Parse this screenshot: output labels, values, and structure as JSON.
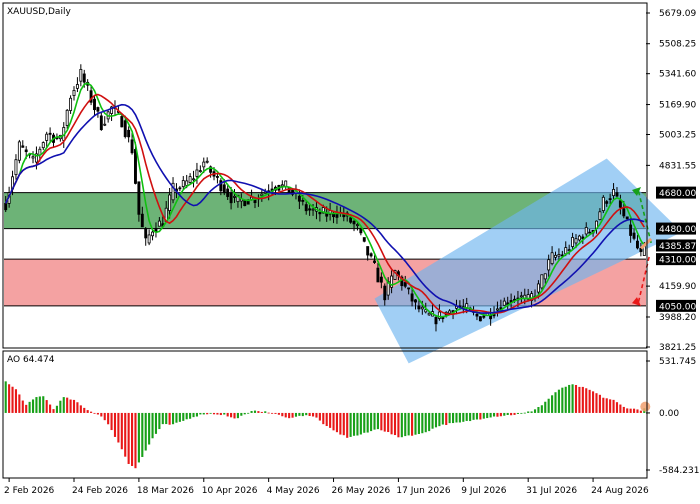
{
  "window": {
    "title": "XAUUSD,Daily",
    "indicator_label": "AO 64.474"
  },
  "colors": {
    "bull_candle": "#ffffff",
    "candle_outline": "#000000",
    "ma_fast": "#10c010",
    "ma_mid": "#d01010",
    "ma_slow": "#1010b0",
    "green_zone": "#3c9a4a",
    "red_zone": "#f07a7a",
    "channel": "#6eb6f0",
    "ao_up": "#18a018",
    "ao_down": "#e81818",
    "forecast_up": "#18a018",
    "forecast_down": "#e81818",
    "forecast_mid": "#f0a070"
  },
  "chart_data": [
    {
      "type": "candlestick",
      "title": "XAUUSD,Daily",
      "ylim": [
        3821.25,
        5700.0
      ],
      "y_ticks": [
        "5679.09",
        "5508.25",
        "5341.60",
        "5169.90",
        "5003.25",
        "4831.55",
        "4159.90",
        "3988.20",
        "3821.25"
      ],
      "y_tick_values": [
        5679.09,
        5508.25,
        5341.6,
        5169.9,
        5003.25,
        4831.55,
        4159.9,
        3988.2,
        3821.25
      ],
      "x_ticks": [
        "2 Feb 2026",
        "24 Feb 2026",
        "18 Mar 2026",
        "10 Apr 2026",
        "4 May 2026",
        "26 May 2026",
        "17 Jun 2026",
        "9 Jul 2026",
        "31 Jul 2026",
        "24 Aug 2026"
      ],
      "x_tick_bars": [
        1,
        20,
        39,
        58,
        77,
        96,
        115,
        134,
        153,
        172
      ],
      "total_bars": 188,
      "levels": [
        {
          "label": "4680.00",
          "value": 4680.0
        },
        {
          "label": "4480.00",
          "value": 4480.0
        },
        {
          "label": "4385.87",
          "value": 4385.87
        },
        {
          "label": "4310.00",
          "value": 4310.0
        },
        {
          "label": "4050.00",
          "value": 4050.0
        }
      ],
      "zones": [
        {
          "from": 4480.0,
          "to": 4680.0,
          "kind": "green"
        },
        {
          "from": 4050.0,
          "to": 4310.0,
          "kind": "red"
        }
      ],
      "channel": {
        "lower": [
          [
            108,
            4020
          ],
          [
            188,
            4520
          ]
        ],
        "upper": [
          [
            188,
            4840
          ]
        ],
        "corners": [
          [
            108,
            4090
          ],
          [
            176,
            4870
          ],
          [
            198,
            4460
          ],
          [
            118,
            3730
          ]
        ]
      },
      "forecast": {
        "start": [
          189,
          4400
        ],
        "up_end": [
          200,
          4700
        ],
        "down_end": [
          200,
          4060
        ],
        "mid_end": [
          196,
          4370
        ]
      },
      "series_keypoints": [
        [
          0,
          4620
        ],
        [
          4,
          4940
        ],
        [
          8,
          4850
        ],
        [
          12,
          5010
        ],
        [
          16,
          4970
        ],
        [
          19,
          5220
        ],
        [
          22,
          5340
        ],
        [
          25,
          5200
        ],
        [
          28,
          5060
        ],
        [
          31,
          5150
        ],
        [
          34,
          5080
        ],
        [
          37,
          4920
        ],
        [
          39,
          4560
        ],
        [
          41,
          4400
        ],
        [
          43,
          4480
        ],
        [
          46,
          4520
        ],
        [
          49,
          4700
        ],
        [
          52,
          4720
        ],
        [
          55,
          4770
        ],
        [
          58,
          4850
        ],
        [
          61,
          4770
        ],
        [
          64,
          4700
        ],
        [
          67,
          4630
        ],
        [
          70,
          4640
        ],
        [
          73,
          4650
        ],
        [
          76,
          4690
        ],
        [
          79,
          4720
        ],
        [
          82,
          4710
        ],
        [
          85,
          4660
        ],
        [
          88,
          4590
        ],
        [
          91,
          4570
        ],
        [
          94,
          4560
        ],
        [
          97,
          4570
        ],
        [
          100,
          4540
        ],
        [
          103,
          4480
        ],
        [
          105,
          4380
        ],
        [
          108,
          4260
        ],
        [
          111,
          4110
        ],
        [
          114,
          4240
        ],
        [
          117,
          4150
        ],
        [
          120,
          4050
        ],
        [
          123,
          4000
        ],
        [
          126,
          3980
        ],
        [
          129,
          4010
        ],
        [
          132,
          4050
        ],
        [
          135,
          4030
        ],
        [
          138,
          3990
        ],
        [
          141,
          4000
        ],
        [
          144,
          4040
        ],
        [
          147,
          4080
        ],
        [
          150,
          4100
        ],
        [
          153,
          4080
        ],
        [
          156,
          4150
        ],
        [
          158,
          4250
        ],
        [
          160,
          4320
        ],
        [
          163,
          4340
        ],
        [
          166,
          4400
        ],
        [
          169,
          4450
        ],
        [
          172,
          4480
        ],
        [
          175,
          4630
        ],
        [
          178,
          4680
        ],
        [
          180,
          4590
        ],
        [
          182,
          4500
        ],
        [
          184,
          4410
        ],
        [
          186,
          4330
        ],
        [
          188,
          4390
        ]
      ]
    },
    {
      "type": "bar",
      "title": "AO 64.474",
      "ylim": [
        -584.231,
        531.745
      ],
      "y_ticks": [
        "531.745",
        "0.00",
        "-584.231"
      ],
      "y_tick_values": [
        531.745,
        0.0,
        -584.231
      ],
      "last_value": 64.474,
      "series_keypoints": [
        [
          0,
          320
        ],
        [
          3,
          240
        ],
        [
          6,
          80
        ],
        [
          9,
          160
        ],
        [
          11,
          175
        ],
        [
          14,
          40
        ],
        [
          17,
          160
        ],
        [
          20,
          130
        ],
        [
          23,
          50
        ],
        [
          26,
          0
        ],
        [
          28,
          -30
        ],
        [
          30,
          -120
        ],
        [
          33,
          -300
        ],
        [
          36,
          -520
        ],
        [
          38,
          -560
        ],
        [
          40,
          -450
        ],
        [
          43,
          -260
        ],
        [
          46,
          -120
        ],
        [
          49,
          -120
        ],
        [
          52,
          -80
        ],
        [
          55,
          -40
        ],
        [
          58,
          -10
        ],
        [
          61,
          -10
        ],
        [
          64,
          -20
        ],
        [
          67,
          -60
        ],
        [
          70,
          -20
        ],
        [
          73,
          30
        ],
        [
          76,
          10
        ],
        [
          79,
          -10
        ],
        [
          82,
          -50
        ],
        [
          85,
          -40
        ],
        [
          88,
          -20
        ],
        [
          91,
          -50
        ],
        [
          94,
          -140
        ],
        [
          97,
          -200
        ],
        [
          100,
          -250
        ],
        [
          103,
          -230
        ],
        [
          106,
          -200
        ],
        [
          109,
          -160
        ],
        [
          112,
          -200
        ],
        [
          115,
          -250
        ],
        [
          118,
          -230
        ],
        [
          121,
          -220
        ],
        [
          124,
          -180
        ],
        [
          127,
          -130
        ],
        [
          130,
          -110
        ],
        [
          133,
          -100
        ],
        [
          136,
          -80
        ],
        [
          139,
          -60
        ],
        [
          142,
          -40
        ],
        [
          145,
          -30
        ],
        [
          148,
          -20
        ],
        [
          151,
          -10
        ],
        [
          154,
          20
        ],
        [
          157,
          80
        ],
        [
          160,
          180
        ],
        [
          163,
          260
        ],
        [
          166,
          290
        ],
        [
          169,
          260
        ],
        [
          172,
          220
        ],
        [
          175,
          160
        ],
        [
          178,
          130
        ],
        [
          181,
          60
        ],
        [
          184,
          40
        ],
        [
          186,
          30
        ],
        [
          188,
          64
        ]
      ]
    }
  ]
}
